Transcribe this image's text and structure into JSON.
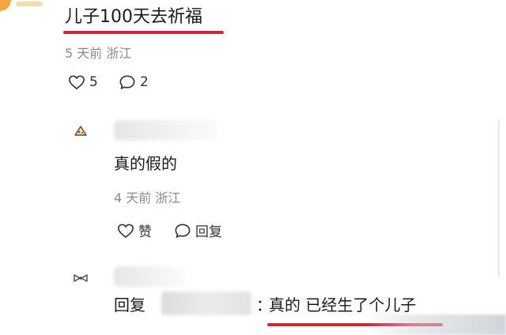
{
  "post": {
    "title": "儿子100天去祈福",
    "meta": "5 天前 浙江",
    "like_count": "5",
    "comment_count": "2"
  },
  "comments": [
    {
      "text": "真的假的",
      "meta": "4 天前 浙江",
      "like_label": "赞",
      "reply_label": "回复"
    },
    {
      "reply_prefix": "回复",
      "colon": "：",
      "text": "真的 已经生了个儿子"
    }
  ],
  "colors": {
    "highlight_underline": "#e3202a",
    "meta_text": "#8a8a8a",
    "body_text": "#1a1a1a"
  },
  "icons": [
    "heart-icon",
    "comment-bubble-icon",
    "avatar-icon"
  ]
}
